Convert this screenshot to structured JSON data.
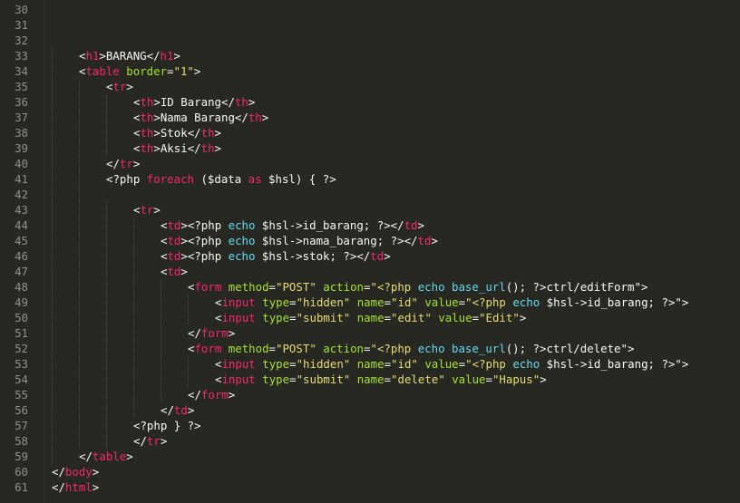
{
  "editor": {
    "colors": {
      "background": "#272822",
      "text": "#f8f8f2",
      "tag": "#f92672",
      "attribute": "#a6e22e",
      "string": "#e6db74",
      "keyword": "#f92672",
      "function": "#66d9ef",
      "line_number": "#90908a"
    },
    "lines": [
      {
        "n": "30",
        "indent": 0,
        "tokens": []
      },
      {
        "n": "31",
        "indent": 0,
        "tokens": []
      },
      {
        "n": "32",
        "indent": 0,
        "tokens": []
      },
      {
        "n": "33",
        "indent": 1,
        "tokens": [
          [
            "t",
            "<"
          ],
          [
            "g",
            "h1"
          ],
          [
            "t",
            ">BARANG</"
          ],
          [
            "g",
            "h1"
          ],
          [
            "t",
            ">"
          ]
        ]
      },
      {
        "n": "34",
        "indent": 1,
        "tokens": [
          [
            "t",
            "<"
          ],
          [
            "g",
            "table"
          ],
          [
            "t",
            " "
          ],
          [
            "a",
            "border"
          ],
          [
            "t",
            "="
          ],
          [
            "s",
            "\"1\""
          ],
          [
            "t",
            ">"
          ]
        ]
      },
      {
        "n": "35",
        "indent": 2,
        "tokens": [
          [
            "t",
            "<"
          ],
          [
            "g",
            "tr"
          ],
          [
            "t",
            ">"
          ]
        ]
      },
      {
        "n": "36",
        "indent": 3,
        "tokens": [
          [
            "t",
            "<"
          ],
          [
            "g",
            "th"
          ],
          [
            "t",
            ">ID Barang</"
          ],
          [
            "g",
            "th"
          ],
          [
            "t",
            ">"
          ]
        ]
      },
      {
        "n": "37",
        "indent": 3,
        "tokens": [
          [
            "t",
            "<"
          ],
          [
            "g",
            "th"
          ],
          [
            "t",
            ">Nama Barang</"
          ],
          [
            "g",
            "th"
          ],
          [
            "t",
            ">"
          ]
        ]
      },
      {
        "n": "38",
        "indent": 3,
        "tokens": [
          [
            "t",
            "<"
          ],
          [
            "g",
            "th"
          ],
          [
            "t",
            ">Stok</"
          ],
          [
            "g",
            "th"
          ],
          [
            "t",
            ">"
          ]
        ]
      },
      {
        "n": "39",
        "indent": 3,
        "tokens": [
          [
            "t",
            "<"
          ],
          [
            "g",
            "th"
          ],
          [
            "t",
            ">Aksi</"
          ],
          [
            "g",
            "th"
          ],
          [
            "t",
            ">"
          ]
        ]
      },
      {
        "n": "40",
        "indent": 2,
        "tokens": [
          [
            "t",
            "</"
          ],
          [
            "g",
            "tr"
          ],
          [
            "t",
            ">"
          ]
        ]
      },
      {
        "n": "41",
        "indent": 2,
        "tokens": [
          [
            "t",
            "<?php "
          ],
          [
            "k",
            "foreach"
          ],
          [
            "t",
            " ($data "
          ],
          [
            "k",
            "as"
          ],
          [
            "t",
            " $hsl) { ?>"
          ]
        ]
      },
      {
        "n": "42",
        "indent": 2,
        "tokens": []
      },
      {
        "n": "43",
        "indent": 3,
        "tokens": [
          [
            "t",
            "<"
          ],
          [
            "g",
            "tr"
          ],
          [
            "t",
            ">"
          ]
        ]
      },
      {
        "n": "44",
        "indent": 4,
        "tokens": [
          [
            "t",
            "<"
          ],
          [
            "g",
            "td"
          ],
          [
            "t",
            "><?php "
          ],
          [
            "f",
            "echo"
          ],
          [
            "t",
            " $hsl->id_barang; ?></"
          ],
          [
            "g",
            "td"
          ],
          [
            "t",
            ">"
          ]
        ]
      },
      {
        "n": "45",
        "indent": 4,
        "tokens": [
          [
            "t",
            "<"
          ],
          [
            "g",
            "td"
          ],
          [
            "t",
            "><?php "
          ],
          [
            "f",
            "echo"
          ],
          [
            "t",
            " $hsl->nama_barang; ?></"
          ],
          [
            "g",
            "td"
          ],
          [
            "t",
            ">"
          ]
        ]
      },
      {
        "n": "46",
        "indent": 4,
        "tokens": [
          [
            "t",
            "<"
          ],
          [
            "g",
            "td"
          ],
          [
            "t",
            "><?php "
          ],
          [
            "f",
            "echo"
          ],
          [
            "t",
            " $hsl->stok; ?></"
          ],
          [
            "g",
            "td"
          ],
          [
            "t",
            ">"
          ]
        ]
      },
      {
        "n": "47",
        "indent": 4,
        "tokens": [
          [
            "t",
            "<"
          ],
          [
            "g",
            "td"
          ],
          [
            "t",
            ">"
          ]
        ]
      },
      {
        "n": "48",
        "indent": 5,
        "tokens": [
          [
            "t",
            "<"
          ],
          [
            "g",
            "form"
          ],
          [
            "t",
            " "
          ],
          [
            "a",
            "method"
          ],
          [
            "t",
            "="
          ],
          [
            "s",
            "\"POST\""
          ],
          [
            "t",
            " "
          ],
          [
            "a",
            "action"
          ],
          [
            "t",
            "="
          ],
          [
            "s",
            "\"<?php "
          ],
          [
            "f",
            "echo"
          ],
          [
            "t",
            " "
          ],
          [
            "f",
            "base_url"
          ],
          [
            "t",
            "(); ?>ctrl/editForm\""
          ],
          [
            "t",
            ">"
          ]
        ]
      },
      {
        "n": "49",
        "indent": 6,
        "tokens": [
          [
            "t",
            "<"
          ],
          [
            "g",
            "input"
          ],
          [
            "t",
            " "
          ],
          [
            "a",
            "type"
          ],
          [
            "t",
            "="
          ],
          [
            "s",
            "\"hidden\""
          ],
          [
            "t",
            " "
          ],
          [
            "a",
            "name"
          ],
          [
            "t",
            "="
          ],
          [
            "s",
            "\"id\""
          ],
          [
            "t",
            " "
          ],
          [
            "a",
            "value"
          ],
          [
            "t",
            "="
          ],
          [
            "s",
            "\"<?php "
          ],
          [
            "f",
            "echo"
          ],
          [
            "t",
            " $hsl->id_barang; ?>\""
          ],
          [
            "t",
            ">"
          ]
        ]
      },
      {
        "n": "50",
        "indent": 6,
        "tokens": [
          [
            "t",
            "<"
          ],
          [
            "g",
            "input"
          ],
          [
            "t",
            " "
          ],
          [
            "a",
            "type"
          ],
          [
            "t",
            "="
          ],
          [
            "s",
            "\"submit\""
          ],
          [
            "t",
            " "
          ],
          [
            "a",
            "name"
          ],
          [
            "t",
            "="
          ],
          [
            "s",
            "\"edit\""
          ],
          [
            "t",
            " "
          ],
          [
            "a",
            "value"
          ],
          [
            "t",
            "="
          ],
          [
            "s",
            "\"Edit\""
          ],
          [
            "t",
            ">"
          ]
        ]
      },
      {
        "n": "51",
        "indent": 5,
        "tokens": [
          [
            "t",
            "</"
          ],
          [
            "g",
            "form"
          ],
          [
            "t",
            ">"
          ]
        ]
      },
      {
        "n": "52",
        "indent": 5,
        "tokens": [
          [
            "t",
            "<"
          ],
          [
            "g",
            "form"
          ],
          [
            "t",
            " "
          ],
          [
            "a",
            "method"
          ],
          [
            "t",
            "="
          ],
          [
            "s",
            "\"POST\""
          ],
          [
            "t",
            " "
          ],
          [
            "a",
            "action"
          ],
          [
            "t",
            "="
          ],
          [
            "s",
            "\"<?php "
          ],
          [
            "f",
            "echo"
          ],
          [
            "t",
            " "
          ],
          [
            "f",
            "base_url"
          ],
          [
            "t",
            "(); ?>ctrl/delete\""
          ],
          [
            "t",
            ">"
          ]
        ]
      },
      {
        "n": "53",
        "indent": 6,
        "tokens": [
          [
            "t",
            "<"
          ],
          [
            "g",
            "input"
          ],
          [
            "t",
            " "
          ],
          [
            "a",
            "type"
          ],
          [
            "t",
            "="
          ],
          [
            "s",
            "\"hidden\""
          ],
          [
            "t",
            " "
          ],
          [
            "a",
            "name"
          ],
          [
            "t",
            "="
          ],
          [
            "s",
            "\"id\""
          ],
          [
            "t",
            " "
          ],
          [
            "a",
            "value"
          ],
          [
            "t",
            "="
          ],
          [
            "s",
            "\"<?php "
          ],
          [
            "f",
            "echo"
          ],
          [
            "t",
            " $hsl->id_barang; ?>\""
          ],
          [
            "t",
            ">"
          ]
        ]
      },
      {
        "n": "54",
        "indent": 6,
        "tokens": [
          [
            "t",
            "<"
          ],
          [
            "g",
            "input"
          ],
          [
            "t",
            " "
          ],
          [
            "a",
            "type"
          ],
          [
            "t",
            "="
          ],
          [
            "s",
            "\"submit\""
          ],
          [
            "t",
            " "
          ],
          [
            "a",
            "name"
          ],
          [
            "t",
            "="
          ],
          [
            "s",
            "\"delete\""
          ],
          [
            "t",
            " "
          ],
          [
            "a",
            "value"
          ],
          [
            "t",
            "="
          ],
          [
            "s",
            "\"Hapus\""
          ],
          [
            "t",
            ">"
          ]
        ]
      },
      {
        "n": "55",
        "indent": 5,
        "tokens": [
          [
            "t",
            "</"
          ],
          [
            "g",
            "form"
          ],
          [
            "t",
            ">"
          ]
        ]
      },
      {
        "n": "56",
        "indent": 4,
        "tokens": [
          [
            "t",
            "</"
          ],
          [
            "g",
            "td"
          ],
          [
            "t",
            ">"
          ]
        ]
      },
      {
        "n": "57",
        "indent": 3,
        "tokens": [
          [
            "t",
            "<?php } ?>"
          ]
        ]
      },
      {
        "n": "58",
        "indent": 3,
        "tokens": [
          [
            "t",
            "</"
          ],
          [
            "g",
            "tr"
          ],
          [
            "t",
            ">"
          ]
        ]
      },
      {
        "n": "59",
        "indent": 1,
        "tokens": [
          [
            "t",
            "</"
          ],
          [
            "g",
            "table"
          ],
          [
            "t",
            ">"
          ]
        ]
      },
      {
        "n": "60",
        "indent": 0,
        "tokens": [
          [
            "t",
            "</"
          ],
          [
            "g",
            "body"
          ],
          [
            "t",
            ">"
          ]
        ]
      },
      {
        "n": "61",
        "indent": 0,
        "tokens": [
          [
            "t",
            "</"
          ],
          [
            "g",
            "html"
          ],
          [
            "t",
            ">"
          ]
        ]
      }
    ]
  }
}
